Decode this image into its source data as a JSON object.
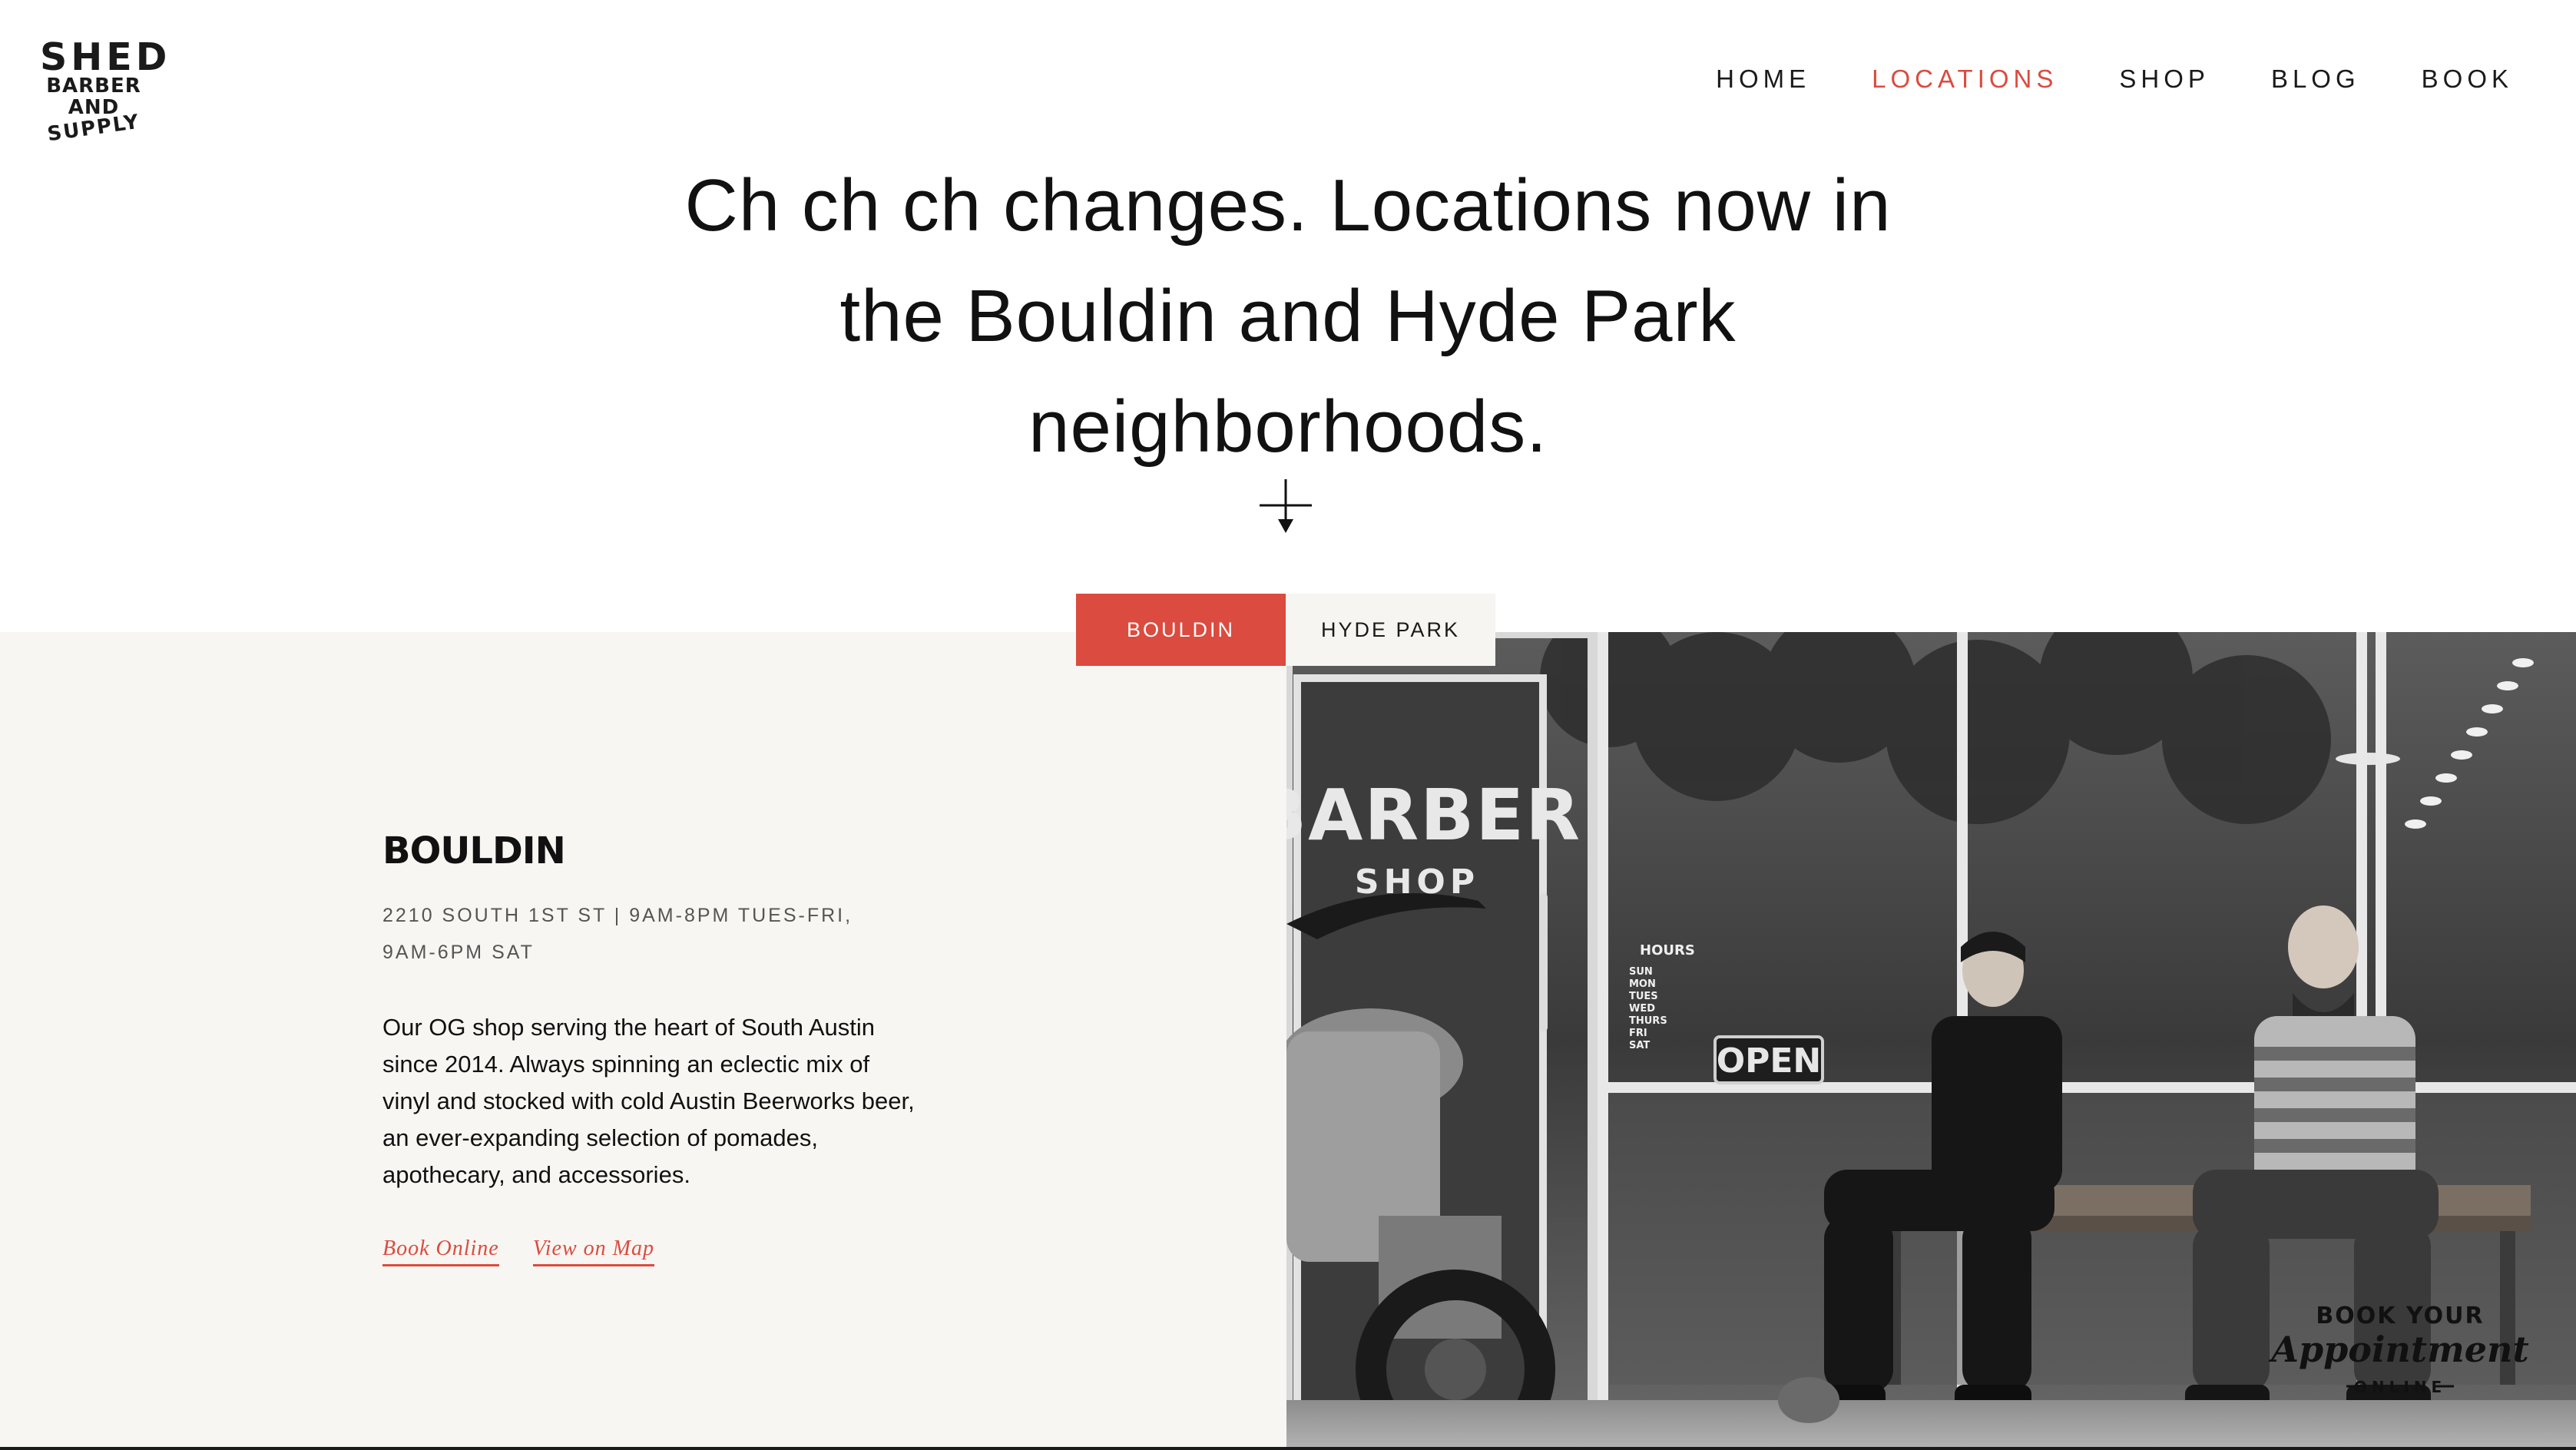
{
  "logo": {
    "line1": "SHED",
    "line2": "BARBER",
    "line3": "AND",
    "line4": "SUPPLY"
  },
  "nav": {
    "items": [
      {
        "label": "HOME",
        "active": false
      },
      {
        "label": "LOCATIONS",
        "active": true
      },
      {
        "label": "SHOP",
        "active": false
      },
      {
        "label": "BLOG",
        "active": false
      },
      {
        "label": "BOOK",
        "active": false
      }
    ]
  },
  "hero": {
    "line1": "Ch ch ch changes. Locations now in",
    "line2": "the Bouldin and Hyde Park",
    "line3": "neighborhoods."
  },
  "tabs": [
    {
      "label": "BOULDIN",
      "active": true
    },
    {
      "label": "HYDE PARK",
      "active": false
    }
  ],
  "location": {
    "name": "BOULDIN",
    "meta_line1": "2210 SOUTH 1ST ST | 9AM-8PM TUES-FRI,",
    "meta_line2": "9AM-6PM SAT",
    "description": "Our OG shop serving the heart of South Austin since 2014. Always spinning an eclectic mix of vinyl and stocked with cold Austin Beerworks beer, an ever-expanding selection of pomades, apothecary, and accessories.",
    "links": {
      "book": "Book Online",
      "map": "View on Map"
    }
  },
  "photo": {
    "sign_barber": "BARBER",
    "sign_shop": "SHOP",
    "sign_open": "OPEN",
    "hours_title": "HOURS",
    "hours_rows": [
      "SUN",
      "MON",
      "TUES",
      "WED",
      "THURS",
      "FRI",
      "SAT"
    ],
    "badge_line1": "BOOK YOUR",
    "badge_line2": "Appointment",
    "badge_line3": "ONLINE"
  },
  "colors": {
    "accent": "#db4b3f",
    "panel_bg": "#f8f6f2",
    "text": "#111111"
  }
}
